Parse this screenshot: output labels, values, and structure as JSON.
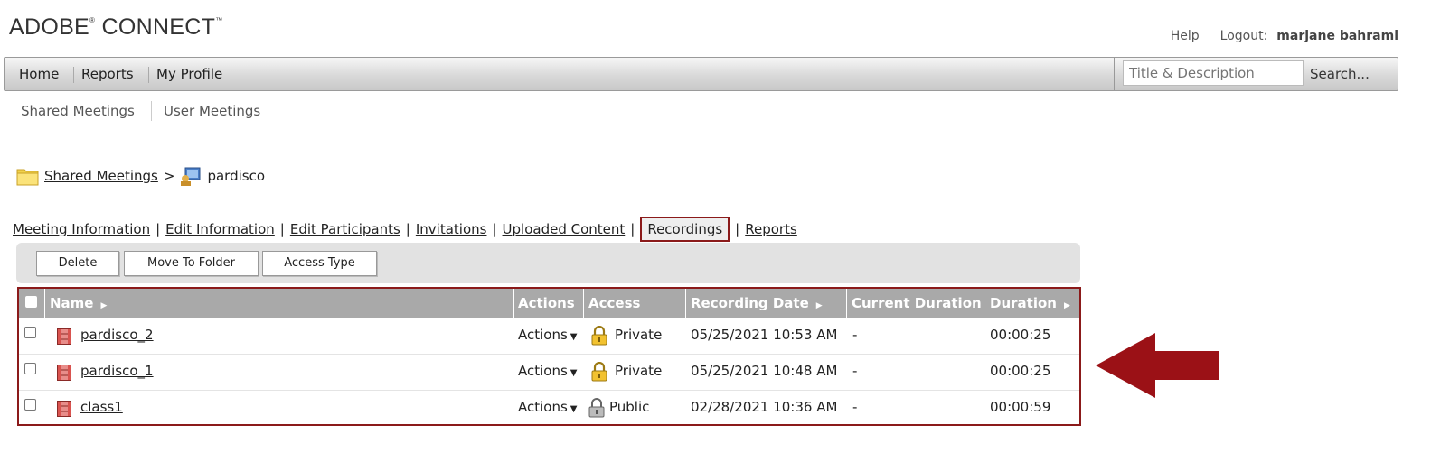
{
  "app": {
    "logo_text": "ADOBE",
    "logo_text2": "CONNECT",
    "reg": "®",
    "tm": "™"
  },
  "top_links": {
    "help": "Help",
    "logout_label": "Logout:",
    "user": "marjane bahrami"
  },
  "nav": {
    "items": [
      "Home",
      "Reports",
      "My Profile"
    ],
    "search_placeholder": "Title & Description",
    "search_button": "Search..."
  },
  "subnav": {
    "items": [
      "Shared Meetings",
      "User Meetings"
    ]
  },
  "breadcrumb": {
    "root": "Shared Meetings",
    "sep": ">",
    "current": "pardisco"
  },
  "tabs": [
    "Meeting Information",
    "Edit Information",
    "Edit Participants",
    "Invitations",
    "Uploaded Content",
    "Recordings",
    "Reports"
  ],
  "toolbar": {
    "delete": "Delete",
    "move": "Move To Folder",
    "access": "Access Type"
  },
  "table": {
    "headers": [
      "Name",
      "Actions",
      "Access",
      "Recording Date",
      "Current Duration",
      "Duration"
    ],
    "rows": [
      {
        "name": "pardisco_2",
        "actions": "Actions",
        "access": "Private",
        "date": "05/25/2021 10:53 AM",
        "current": "-",
        "duration": "00:00:25"
      },
      {
        "name": "pardisco_1",
        "actions": "Actions",
        "access": "Private",
        "date": "05/25/2021 10:48 AM",
        "current": "-",
        "duration": "00:00:25"
      },
      {
        "name": "class1",
        "actions": "Actions",
        "access": "Public",
        "date": "02/28/2021 10:36 AM",
        "current": "-",
        "duration": "00:00:59"
      }
    ]
  },
  "colors": {
    "highlight": "#8b1a1a",
    "arrow": "#9b1116",
    "header_bg": "#a9a9a9"
  }
}
